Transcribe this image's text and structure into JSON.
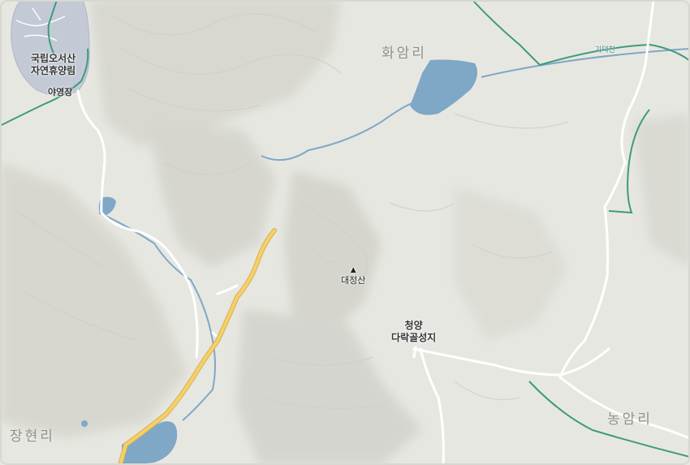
{
  "map": {
    "colors": {
      "land": "#e6e6e0",
      "water": "#7fa7c6",
      "road_main": "#f4d06b",
      "road_minor": "#ffffff",
      "boundary": "#3f9a7d",
      "forest": "#c2c9d4"
    },
    "labels": {
      "forest_name_line1": "국립오서산",
      "forest_name_line2": "자연휴양림",
      "campsite": "야영장",
      "village_hwaam": "화암리",
      "stream_gideok": "기덕천",
      "peak_marker": "▲",
      "peak_name": "대정산",
      "holy_site_line1": "청양",
      "holy_site_line2": "다락골성지",
      "village_nongam": "농암리",
      "village_janghyeon": "장현리"
    }
  }
}
